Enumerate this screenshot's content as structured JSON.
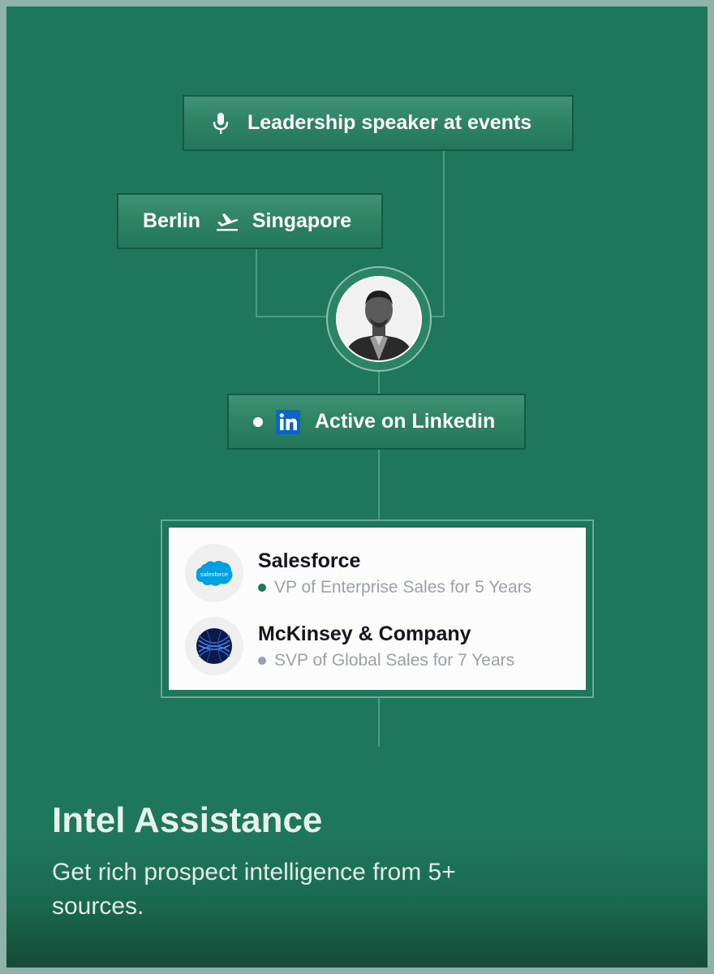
{
  "pills": {
    "speaker": {
      "label": "Leadership speaker at events",
      "icon": "microphone-icon"
    },
    "travel": {
      "from": "Berlin",
      "to": "Singapore",
      "icon": "plane-takeoff-icon"
    },
    "linkedin": {
      "label": "Active on Linkedin",
      "icon": "linkedin-icon",
      "indicator": "white-dot"
    }
  },
  "profile": {
    "avatar": "person-avatar"
  },
  "experience": [
    {
      "company": "Salesforce",
      "role": "VP of Enterprise Sales for 5 Years",
      "logo": "salesforce-logo",
      "logo_text": "salesforce",
      "dot_color": "#1f775b"
    },
    {
      "company": "McKinsey & Company",
      "role": "SVP of Global Sales for 7 Years",
      "logo": "mckinsey-logo",
      "dot_color": "#9aa0ac"
    }
  ],
  "feature": {
    "title": "Intel Assistance",
    "description": "Get rich prospect intelligence from 5+ sources."
  },
  "colors": {
    "background": "#1f775b",
    "pill": "#2f8466",
    "card": "#fcfcfd",
    "accent_dot": "#1f775b",
    "muted_dot": "#9aa0ac"
  }
}
